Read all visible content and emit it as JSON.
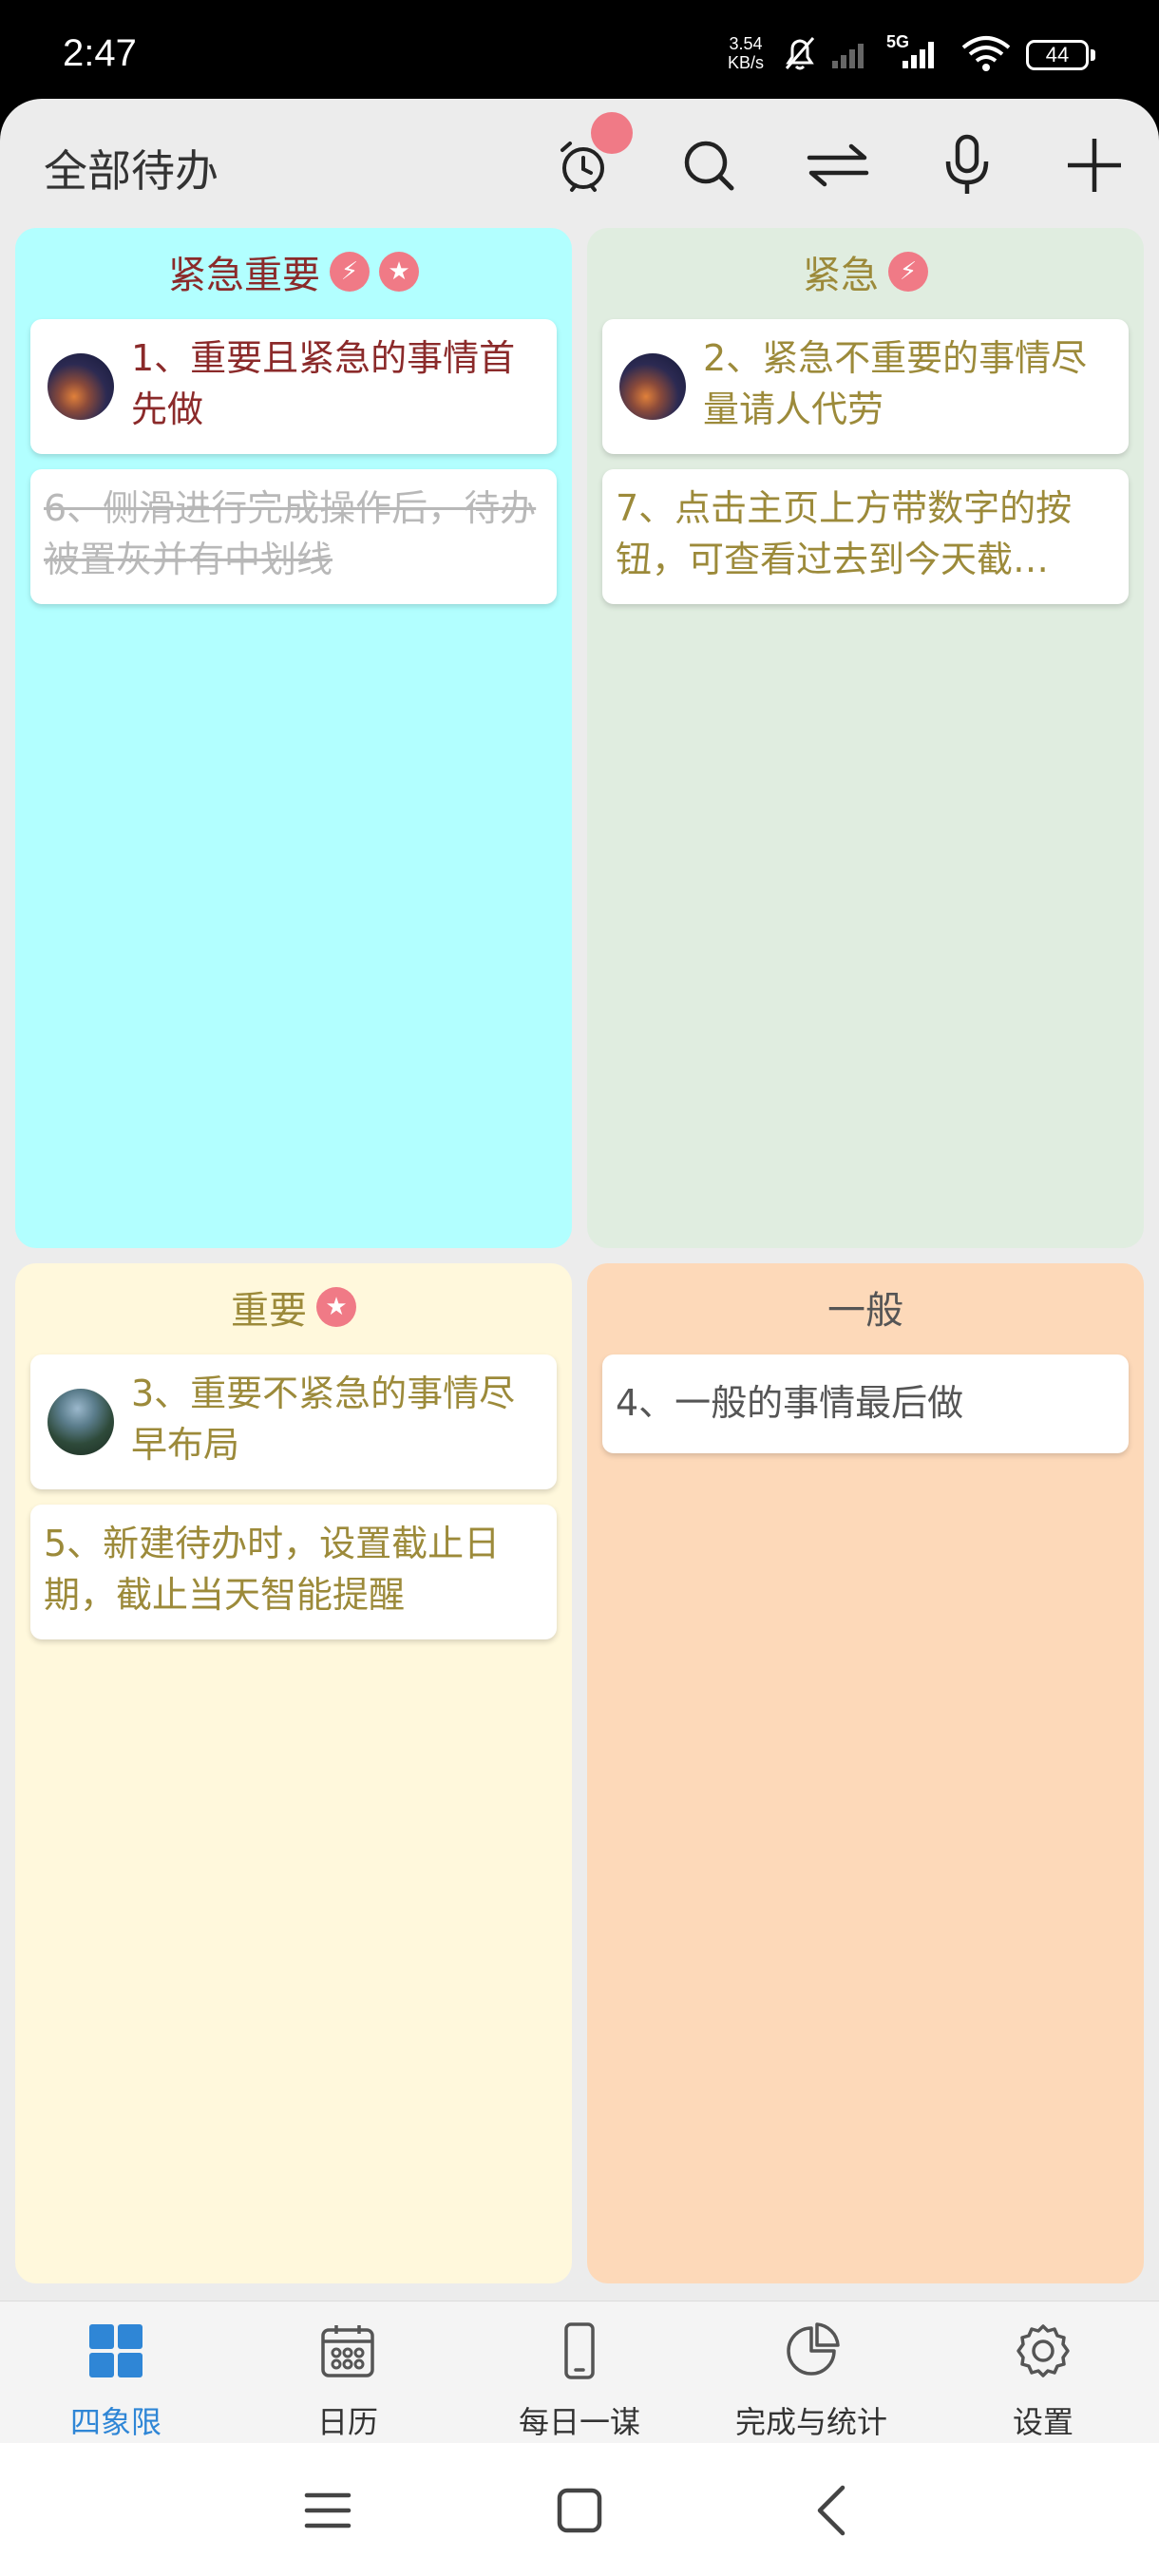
{
  "status_bar": {
    "time": "2:47",
    "net_speed_value": "3.54",
    "net_speed_unit": "KB/s",
    "network_type": "5G",
    "battery": "44"
  },
  "app_bar": {
    "title": "全部待办",
    "icons": [
      "alarm-clock-icon",
      "search-icon",
      "swap-icon",
      "microphone-icon",
      "plus-icon"
    ],
    "accent_dot_color": "#f07a86"
  },
  "quadrants": {
    "q1": {
      "title": "紧急重要",
      "badges": [
        "⚡",
        "★"
      ],
      "color": "#b2ffff",
      "cards": [
        {
          "text": "1、重要且紧急的事情首先做",
          "has_avatar": true,
          "avatar": "sunset",
          "done": false
        },
        {
          "text": "6、侧滑进行完成操作后，待办被置灰并有中划线",
          "has_avatar": false,
          "done": true
        }
      ]
    },
    "q2": {
      "title": "紧急",
      "badges": [
        "⚡"
      ],
      "color": "#e0ede0",
      "cards": [
        {
          "text": "2、紧急不重要的事情尽量请人代劳",
          "has_avatar": true,
          "avatar": "sunset",
          "done": false
        },
        {
          "text": "7、点击主页上方带数字的按钮，可查看过去到今天截…",
          "has_avatar": false,
          "done": false
        }
      ]
    },
    "q3": {
      "title": "重要",
      "badges": [
        "★"
      ],
      "color": "#fff8dc",
      "cards": [
        {
          "text": "3、重要不紧急的事情尽早布局",
          "has_avatar": true,
          "avatar": "mountain",
          "done": false
        },
        {
          "text": "5、新建待办时，设置截止日期，截止当天智能提醒",
          "has_avatar": false,
          "done": false
        }
      ]
    },
    "q4": {
      "title": "一般",
      "badges": [],
      "color": "#fdd9b9",
      "cards": [
        {
          "text": "4、一般的事情最后做",
          "has_avatar": false,
          "done": false
        }
      ]
    }
  },
  "bottom_nav": {
    "active_color": "#2f86d6",
    "items": [
      {
        "label": "四象限",
        "icon": "quadrant-grid-icon",
        "active": true
      },
      {
        "label": "日历",
        "icon": "calendar-icon",
        "active": false
      },
      {
        "label": "每日一谋",
        "icon": "phone-icon",
        "active": false
      },
      {
        "label": "完成与统计",
        "icon": "pie-chart-icon",
        "active": false
      },
      {
        "label": "设置",
        "icon": "settings-gear-icon",
        "active": false
      }
    ]
  },
  "system_nav": {
    "icons": [
      "menu-icon",
      "home-icon",
      "back-icon"
    ]
  }
}
